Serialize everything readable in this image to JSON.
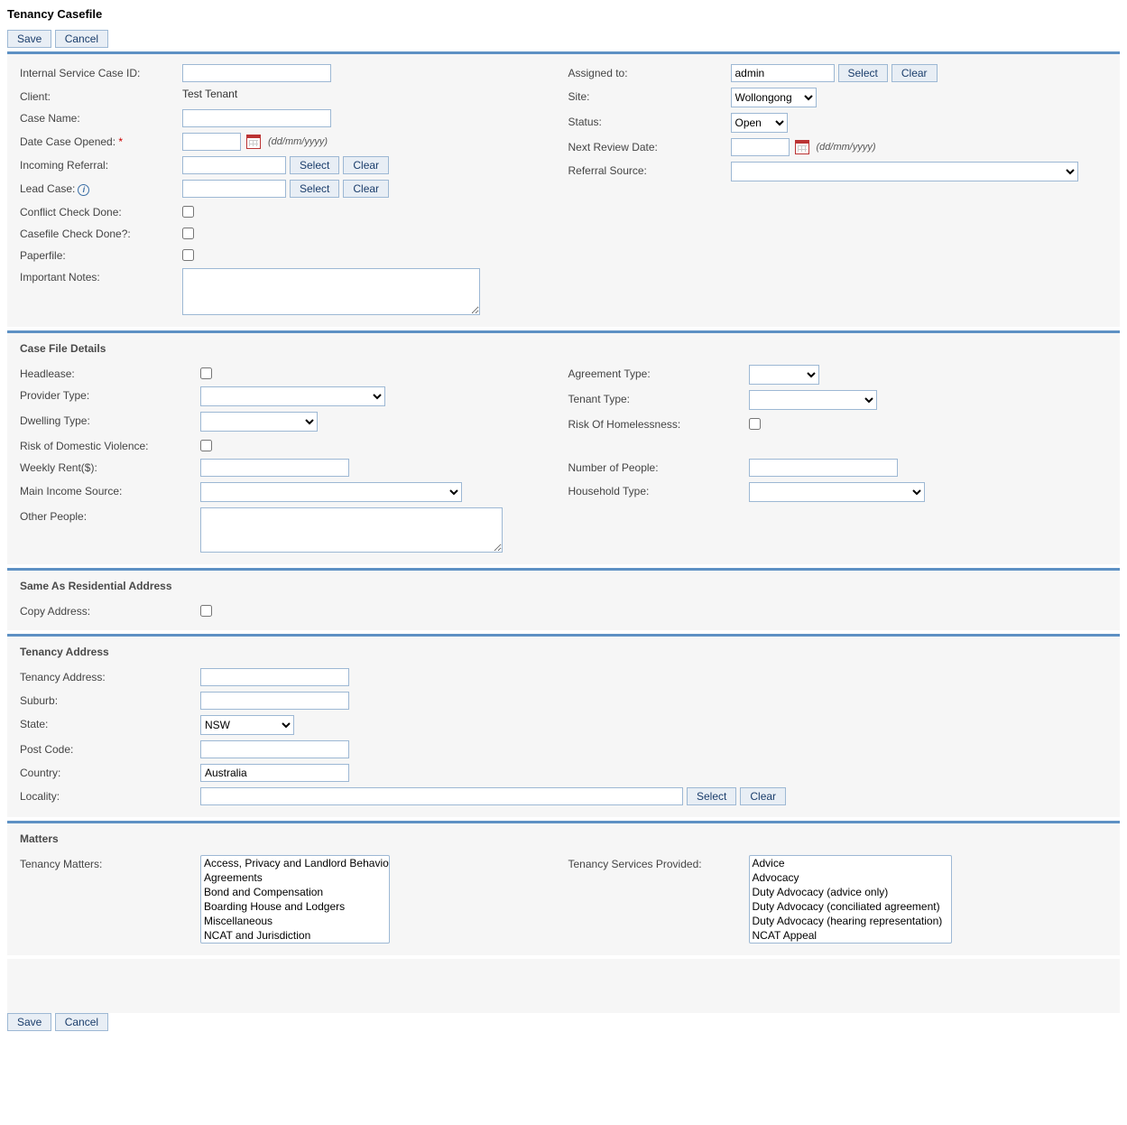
{
  "page": {
    "title": "Tenancy Casefile"
  },
  "buttons": {
    "save": "Save",
    "cancel": "Cancel",
    "select": "Select",
    "clear": "Clear"
  },
  "hints": {
    "date_format": "(dd/mm/yyyy)"
  },
  "main": {
    "labels": {
      "internal_id": "Internal Service Case ID:",
      "client": "Client:",
      "case_name": "Case Name:",
      "date_opened": "Date Case Opened:",
      "incoming_referral": "Incoming Referral:",
      "lead_case": "Lead Case:",
      "conflict_check": "Conflict Check Done:",
      "casefile_check": "Casefile Check Done?:",
      "paperfile": "Paperfile:",
      "important_notes": "Important Notes:",
      "assigned_to": "Assigned to:",
      "site": "Site:",
      "status": "Status:",
      "next_review": "Next Review Date:",
      "referral_source": "Referral Source:"
    },
    "values": {
      "internal_id": "",
      "client": "Test Tenant",
      "case_name": "",
      "date_opened": "",
      "incoming_referral": "",
      "lead_case": "",
      "important_notes": "",
      "assigned_to": "admin",
      "site_selected": "Wollongong",
      "status_selected": "Open",
      "next_review": "",
      "referral_source": ""
    }
  },
  "details": {
    "title": "Case File Details",
    "labels": {
      "headlease": "Headlease:",
      "provider_type": "Provider Type:",
      "dwelling_type": "Dwelling Type:",
      "risk_dv": "Risk of Domestic Violence:",
      "weekly_rent": "Weekly Rent($):",
      "main_income": "Main Income Source:",
      "other_people": "Other People:",
      "agreement_type": "Agreement Type:",
      "tenant_type": "Tenant Type:",
      "risk_homeless": "Risk Of Homelessness:",
      "num_people": "Number of People:",
      "household_type": "Household Type:"
    }
  },
  "same_addr": {
    "title": "Same As Residential Address",
    "labels": {
      "copy": "Copy Address:"
    }
  },
  "address": {
    "title": "Tenancy Address",
    "labels": {
      "address": "Tenancy Address:",
      "suburb": "Suburb:",
      "state": "State:",
      "postcode": "Post Code:",
      "country": "Country:",
      "locality": "Locality:"
    },
    "values": {
      "address": "",
      "suburb": "",
      "state_selected": "NSW",
      "postcode": "",
      "country": "Australia",
      "locality": ""
    }
  },
  "matters": {
    "title": "Matters",
    "labels": {
      "tenancy_matters": "Tenancy Matters:",
      "services_provided": "Tenancy Services Provided:"
    },
    "tenancy_matters_options": [
      "Access, Privacy and Landlord Behaviour",
      "Agreements",
      "Bond and Compensation",
      "Boarding House and Lodgers",
      "Miscellaneous",
      "NCAT and Jurisdiction"
    ],
    "services_options": [
      "Advice",
      "Advocacy",
      "Duty Advocacy (advice only)",
      "Duty Advocacy (conciliated agreement)",
      "Duty Advocacy (hearing representation)",
      "NCAT Appeal"
    ]
  }
}
